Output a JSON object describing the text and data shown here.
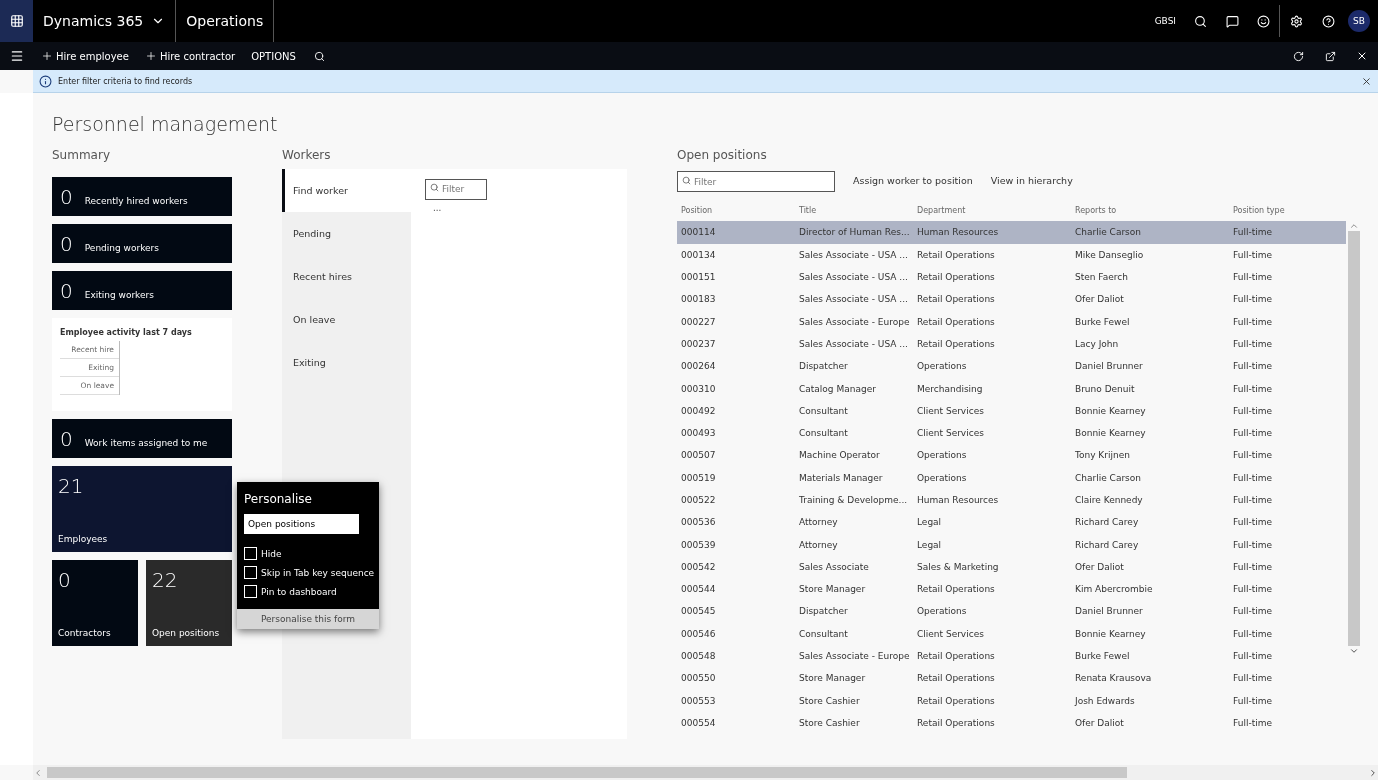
{
  "nav": {
    "product": "Dynamics 365",
    "module": "Operations",
    "company": "GBSI",
    "user_initials": "SB"
  },
  "action_bar": {
    "actions": [
      {
        "label": "Hire employee",
        "kind": "add"
      },
      {
        "label": "Hire contractor",
        "kind": "add"
      },
      {
        "label": "OPTIONS",
        "kind": "plain"
      }
    ]
  },
  "info_bar": {
    "message": "Enter filter criteria to find records"
  },
  "page_title": "Personnel management",
  "summary": {
    "heading": "Summary",
    "tiles": [
      {
        "kind": "count",
        "value": "0",
        "label": "Recently hired workers"
      },
      {
        "kind": "count",
        "value": "0",
        "label": "Pending workers"
      },
      {
        "kind": "count",
        "value": "0",
        "label": "Exiting workers"
      },
      {
        "kind": "chart",
        "title": "Employee activity last 7 days",
        "categories": [
          "Recent hire",
          "Exiting",
          "On leave"
        ]
      },
      {
        "kind": "count",
        "value": "0",
        "label": "Work items assigned to me"
      },
      {
        "kind": "big",
        "value": "21",
        "label": "Employees"
      }
    ],
    "small_tiles": [
      {
        "value": "0",
        "label": "Contractors",
        "selected": false
      },
      {
        "value": "22",
        "label": "Open positions",
        "selected": true
      }
    ]
  },
  "personalise": {
    "title": "Personalise",
    "name_value": "Open positions",
    "options": [
      {
        "label": "Hide",
        "checked": false
      },
      {
        "label": "Skip in Tab key sequence",
        "checked": false
      },
      {
        "label": "Pin to dashboard",
        "checked": false
      }
    ],
    "footer": "Personalise this form"
  },
  "workers": {
    "heading": "Workers",
    "tabs": [
      {
        "label": "Find worker",
        "selected": true
      },
      {
        "label": "Pending",
        "selected": false
      },
      {
        "label": "Recent hires",
        "selected": false
      },
      {
        "label": "On leave",
        "selected": false
      },
      {
        "label": "Exiting",
        "selected": false
      }
    ],
    "filter_placeholder": "Filter",
    "more": "..."
  },
  "open_positions": {
    "heading": "Open positions",
    "filter_placeholder": "Filter",
    "actions": [
      "Assign worker to position",
      "View in hierarchy"
    ],
    "columns": [
      "Position",
      "Title",
      "Department",
      "Reports to",
      "Position type"
    ],
    "rows": [
      {
        "cells": [
          "000114",
          "Director of Human Res...",
          "Human Resources",
          "Charlie Carson",
          "Full-time"
        ],
        "selected": true
      },
      {
        "cells": [
          "000134",
          "Sales Associate - USA ...",
          "Retail Operations",
          "Mike Danseglio",
          "Full-time"
        ],
        "selected": false
      },
      {
        "cells": [
          "000151",
          "Sales Associate - USA ...",
          "Retail Operations",
          "Sten Faerch",
          "Full-time"
        ],
        "selected": false
      },
      {
        "cells": [
          "000183",
          "Sales Associate - USA ...",
          "Retail Operations",
          "Ofer Daliot",
          "Full-time"
        ],
        "selected": false
      },
      {
        "cells": [
          "000227",
          "Sales Associate - Europe",
          "Retail Operations",
          "Burke Fewel",
          "Full-time"
        ],
        "selected": false
      },
      {
        "cells": [
          "000237",
          "Sales Associate - USA ...",
          "Retail Operations",
          "Lacy John",
          "Full-time"
        ],
        "selected": false
      },
      {
        "cells": [
          "000264",
          "Dispatcher",
          "Operations",
          "Daniel Brunner",
          "Full-time"
        ],
        "selected": false
      },
      {
        "cells": [
          "000310",
          "Catalog Manager",
          "Merchandising",
          "Bruno Denuit",
          "Full-time"
        ],
        "selected": false
      },
      {
        "cells": [
          "000492",
          "Consultant",
          "Client Services",
          "Bonnie Kearney",
          "Full-time"
        ],
        "selected": false
      },
      {
        "cells": [
          "000493",
          "Consultant",
          "Client Services",
          "Bonnie Kearney",
          "Full-time"
        ],
        "selected": false
      },
      {
        "cells": [
          "000507",
          "Machine Operator",
          "Operations",
          "Tony Krijnen",
          "Full-time"
        ],
        "selected": false
      },
      {
        "cells": [
          "000519",
          "Materials Manager",
          "Operations",
          "Charlie Carson",
          "Full-time"
        ],
        "selected": false
      },
      {
        "cells": [
          "000522",
          "Training & Developme...",
          "Human Resources",
          "Claire Kennedy",
          "Full-time"
        ],
        "selected": false
      },
      {
        "cells": [
          "000536",
          "Attorney",
          "Legal",
          "Richard Carey",
          "Full-time"
        ],
        "selected": false
      },
      {
        "cells": [
          "000539",
          "Attorney",
          "Legal",
          "Richard Carey",
          "Full-time"
        ],
        "selected": false
      },
      {
        "cells": [
          "000542",
          "Sales Associate",
          "Sales & Marketing",
          "Ofer Daliot",
          "Full-time"
        ],
        "selected": false
      },
      {
        "cells": [
          "000544",
          "Store Manager",
          "Retail Operations",
          "Kim Abercrombie",
          "Full-time"
        ],
        "selected": false
      },
      {
        "cells": [
          "000545",
          "Dispatcher",
          "Operations",
          "Daniel Brunner",
          "Full-time"
        ],
        "selected": false
      },
      {
        "cells": [
          "000546",
          "Consultant",
          "Client Services",
          "Bonnie Kearney",
          "Full-time"
        ],
        "selected": false
      },
      {
        "cells": [
          "000548",
          "Sales Associate - Europe",
          "Retail Operations",
          "Burke Fewel",
          "Full-time"
        ],
        "selected": false
      },
      {
        "cells": [
          "000550",
          "Store Manager",
          "Retail Operations",
          "Renata Krausova",
          "Full-time"
        ],
        "selected": false
      },
      {
        "cells": [
          "000553",
          "Store Cashier",
          "Retail Operations",
          "Josh Edwards",
          "Full-time"
        ],
        "selected": false
      },
      {
        "cells": [
          "000554",
          "Store Cashier",
          "Retail Operations",
          "Ofer Daliot",
          "Full-time"
        ],
        "selected": false
      }
    ]
  }
}
